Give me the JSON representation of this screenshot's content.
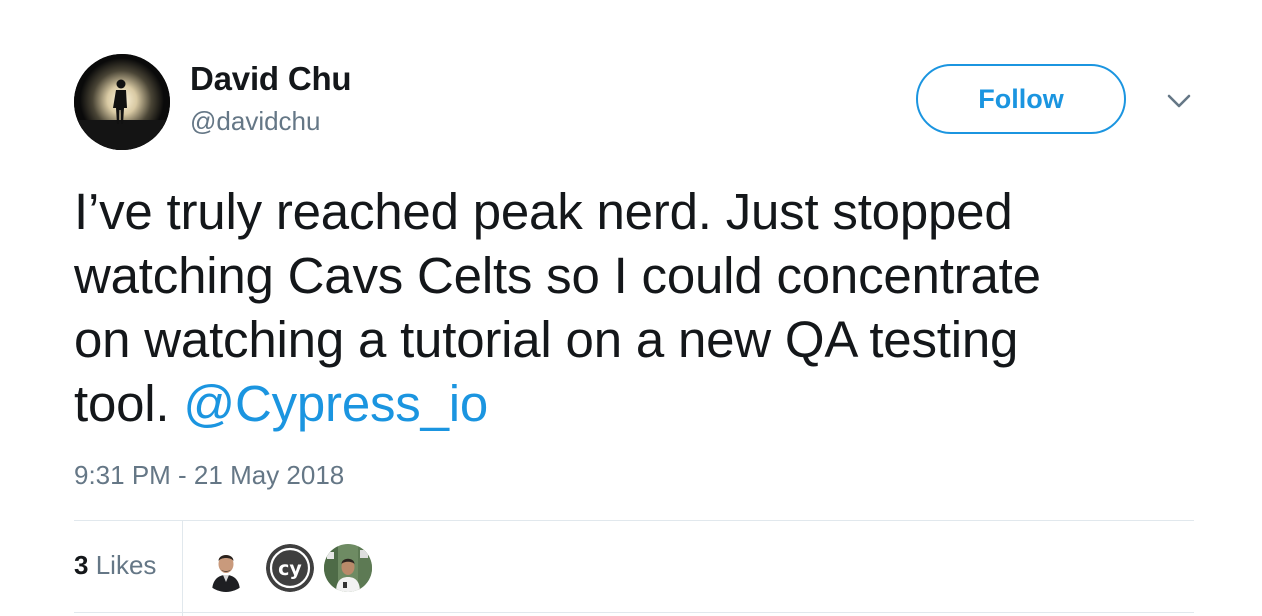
{
  "author": {
    "display_name": "David Chu",
    "handle": "@davidchu",
    "avatar_icon": "silhouette-sunset-avatar"
  },
  "actions": {
    "follow_label": "Follow",
    "menu_icon": "chevron-down-icon"
  },
  "tweet": {
    "text_lines": [
      "I’ve truly reached peak nerd. Just stopped",
      "watching Cavs Celts so I could concentrate",
      "on watching a tutorial on a new QA testing",
      "tool. "
    ],
    "mention": "@Cypress_io",
    "timestamp": "9:31 PM - 21 May 2018"
  },
  "stats": {
    "likes_count": "3",
    "likes_label": "Likes",
    "likers": [
      {
        "icon": "person-avatar"
      },
      {
        "icon": "cypress-logo-avatar",
        "text": "cy"
      },
      {
        "icon": "person-outdoor-avatar"
      }
    ]
  },
  "colors": {
    "accent": "#1b95e0",
    "text_primary": "#14171a",
    "text_secondary": "#657786",
    "divider": "#e1e8ed"
  }
}
